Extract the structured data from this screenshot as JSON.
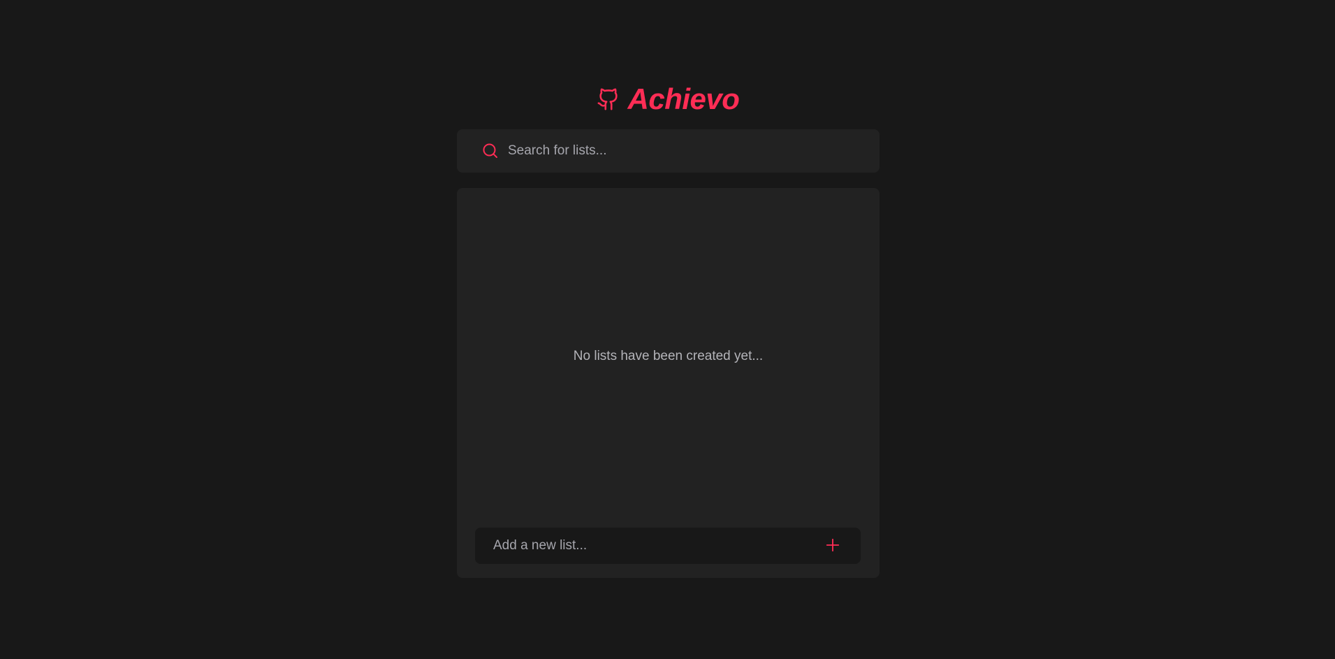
{
  "header": {
    "title": "Achievo",
    "logo_icon": "github-icon",
    "accent_color": "#ff2d55"
  },
  "search": {
    "placeholder": "Search for lists...",
    "value": "",
    "icon": "search-icon"
  },
  "lists": {
    "items": [],
    "empty_message": "No lists have been created yet..."
  },
  "add_list": {
    "placeholder": "Add a new list...",
    "value": "",
    "button_icon": "plus-icon"
  },
  "colors": {
    "background": "#181818",
    "panel": "#222222",
    "accent": "#ff2d55",
    "muted_text": "#a6a6ad"
  }
}
